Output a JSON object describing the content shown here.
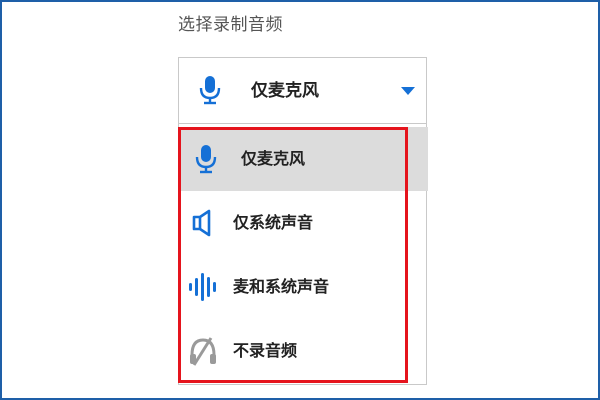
{
  "section": {
    "label": "选择录制音频"
  },
  "select": {
    "value": "仅麦克风",
    "icon": "microphone-icon",
    "accent": "#1570d6"
  },
  "options": [
    {
      "label": "仅麦克风",
      "icon": "microphone-icon",
      "selected": true
    },
    {
      "label": "仅系统声音",
      "icon": "speaker-icon",
      "selected": false
    },
    {
      "label": "麦和系统声音",
      "icon": "sound-wave-icon",
      "selected": false
    },
    {
      "label": "不录音频",
      "icon": "no-audio-icon",
      "selected": false
    }
  ],
  "colors": {
    "accent": "#1570d6",
    "highlight": "#e5141d",
    "selected_bg": "#dcdcdc",
    "disabled_icon": "#9a9a9a",
    "frame": "#1e5fa8"
  }
}
